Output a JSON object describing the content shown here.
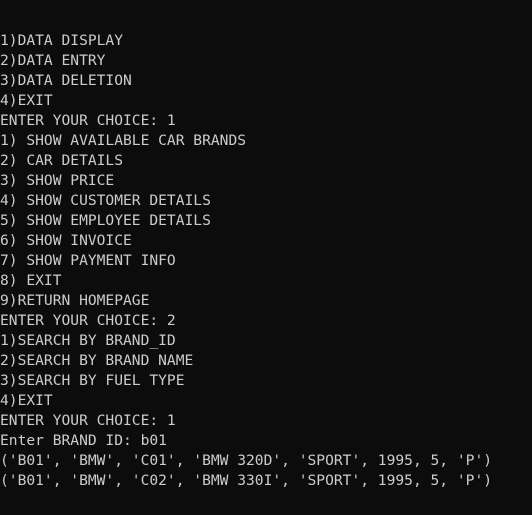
{
  "terminal": {
    "lines": [
      "1)DATA DISPLAY",
      "2)DATA ENTRY",
      "3)DATA DELETION",
      "4)EXIT",
      "ENTER YOUR CHOICE: 1",
      "1) SHOW AVAILABLE CAR BRANDS",
      "2) CAR DETAILS",
      "3) SHOW PRICE",
      "4) SHOW CUSTOMER DETAILS",
      "5) SHOW EMPLOYEE DETAILS",
      "6) SHOW INVOICE",
      "7) SHOW PAYMENT INFO",
      "8) EXIT",
      "9)RETURN HOMEPAGE",
      "ENTER YOUR CHOICE: 2",
      "1)SEARCH BY BRAND_ID",
      "2)SEARCH BY BRAND NAME",
      "3)SEARCH BY FUEL TYPE",
      "4)EXIT",
      "ENTER YOUR CHOICE: 1",
      "Enter BRAND ID: b01",
      "('B01', 'BMW', 'C01', 'BMW 320D', 'SPORT', 1995, 5, 'P')",
      "('B01', 'BMW', 'C02', 'BMW 330I', 'SPORT', 1995, 5, 'P')"
    ]
  }
}
